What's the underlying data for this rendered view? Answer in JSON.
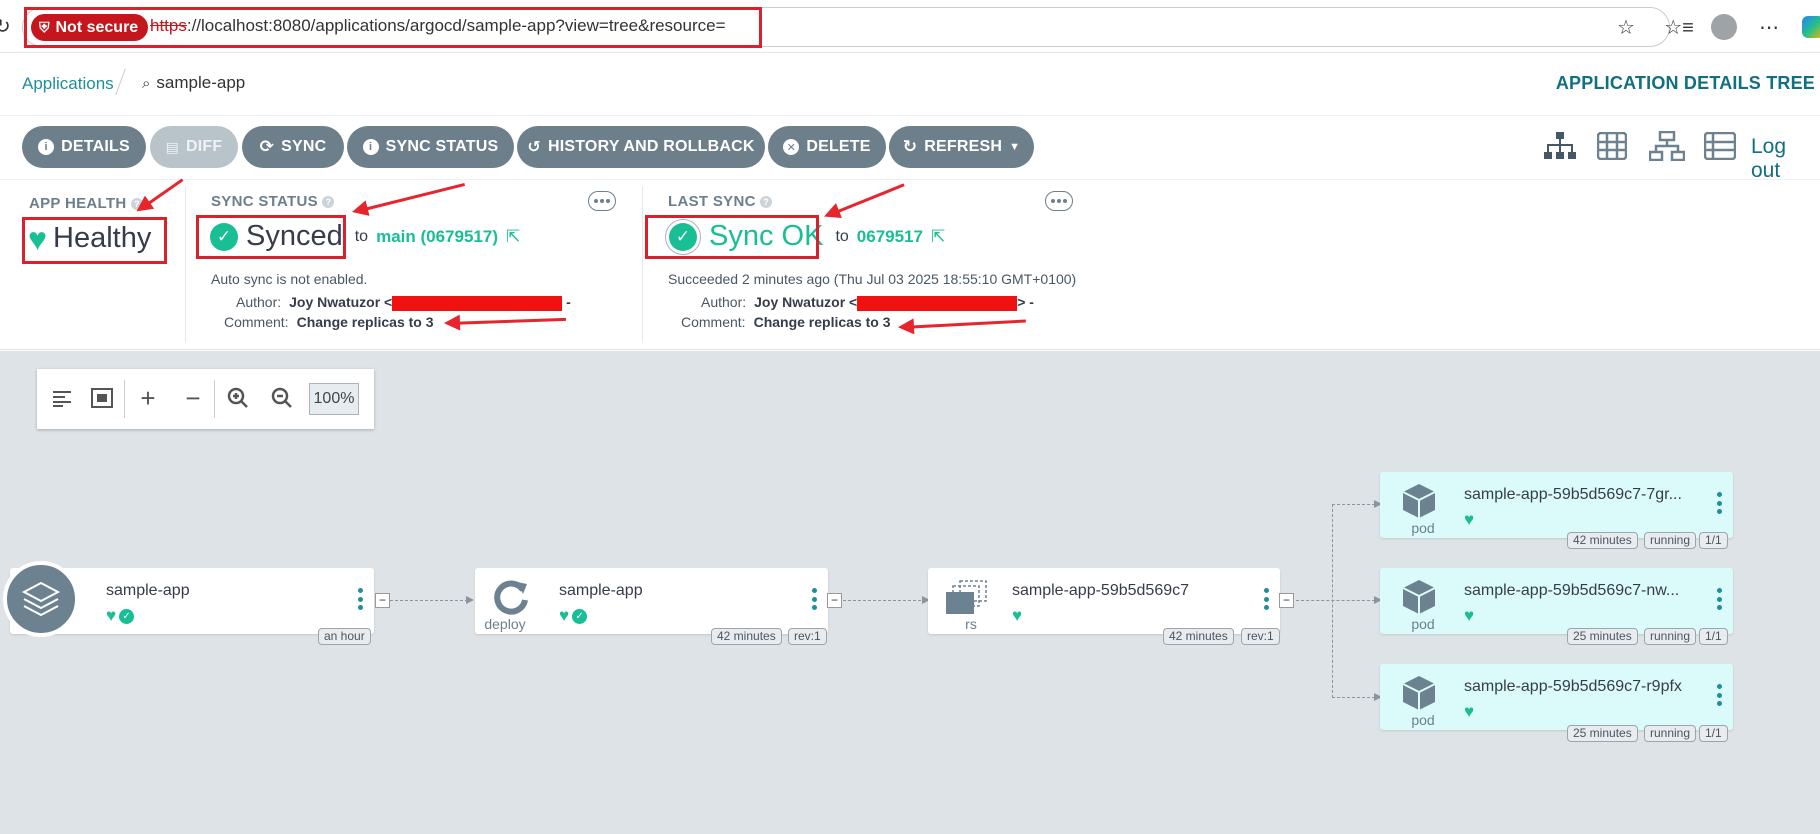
{
  "browser": {
    "not_secure": "Not secure",
    "url_scheme": "https",
    "url_rest": "://localhost:8080/applications/argocd/sample-app?view=tree&resource="
  },
  "header": {
    "breadcrumb_root": "Applications",
    "breadcrumb_current": "sample-app",
    "page_title": "APPLICATION DETAILS TREE"
  },
  "toolbar": {
    "buttons": [
      {
        "label": "DETAILS",
        "icon": "info-icon"
      },
      {
        "label": "DIFF",
        "icon": "file-diff-icon"
      },
      {
        "label": "SYNC",
        "icon": "sync-icon"
      },
      {
        "label": "SYNC STATUS",
        "icon": "info-icon"
      },
      {
        "label": "HISTORY AND ROLLBACK",
        "icon": "history-icon"
      },
      {
        "label": "DELETE",
        "icon": "close-circle-icon"
      },
      {
        "label": "REFRESH",
        "icon": "refresh-icon"
      }
    ],
    "logout": "Log out"
  },
  "app_health": {
    "label": "APP HEALTH",
    "value": "Healthy"
  },
  "sync_status": {
    "label": "SYNC STATUS",
    "value": "Synced",
    "to": "to",
    "revision": "main (0679517)",
    "auto_sync": "Auto sync is not enabled.",
    "author_label": "Author:",
    "author": "Joy Nwatuzor <",
    "author_suffix": "-",
    "comment_label": "Comment:",
    "comment": "Change replicas to 3"
  },
  "last_sync": {
    "label": "LAST SYNC",
    "value": "Sync OK",
    "to": "to",
    "revision": "0679517",
    "succeeded": "Succeeded 2 minutes ago (Thu Jul 03 2025 18:55:10 GMT+0100)",
    "author_label": "Author:",
    "author": "Joy Nwatuzor <",
    "author_suffix": "> -",
    "comment_label": "Comment:",
    "comment": "Change replicas to 3"
  },
  "zoom": {
    "level": "100%"
  },
  "nodes": {
    "app": {
      "name": "sample-app",
      "age": "an hour"
    },
    "deploy": {
      "name": "sample-app",
      "kind": "deploy",
      "age": "42 minutes",
      "rev": "rev:1"
    },
    "rs": {
      "name": "sample-app-59b5d569c7",
      "kind": "rs",
      "age": "42 minutes",
      "rev": "rev:1"
    },
    "pods": [
      {
        "name": "sample-app-59b5d569c7-7gr...",
        "kind": "pod",
        "age": "42 minutes",
        "state": "running",
        "ready": "1/1"
      },
      {
        "name": "sample-app-59b5d569c7-nw...",
        "kind": "pod",
        "age": "25 minutes",
        "state": "running",
        "ready": "1/1"
      },
      {
        "name": "sample-app-59b5d569c7-r9pfx",
        "kind": "pod",
        "age": "25 minutes",
        "state": "running",
        "ready": "1/1"
      }
    ]
  },
  "colors": {
    "accent": "#1d8f9b",
    "healthy": "#18be94",
    "button": "#6d7f8b",
    "annotation_red": "#e8242c"
  }
}
